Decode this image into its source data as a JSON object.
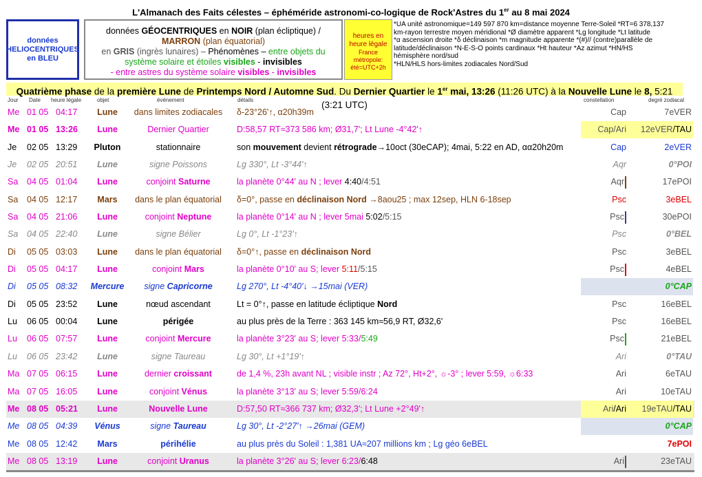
{
  "title": {
    "pre": "L'Almanach des Faits célestes – éphéméride astronomi-co-logique de Rock'Astres du 1",
    "sup": "er",
    "post": " au 8 mai 2024"
  },
  "legend": {
    "helio": [
      "données",
      "HELIOCENTRIQUES",
      "en BLEU"
    ],
    "geo_l1a": "données ",
    "geo_l1b": "GÉOCENTRIQUES",
    "geo_l1c": " en ",
    "geo_l1d": "NOIR",
    "geo_l1e": " (plan écliptique)  /",
    "geo_l2a": "MARRON",
    "geo_l2b": " (plan équatorial)",
    "geo_l3a": "en ",
    "geo_l3b": "GRIS",
    "geo_l3c": " (ingrès lunaires) – ",
    "geo_l3d": "Phénomènes – ",
    "geo_l3e": "entre objets du",
    "geo_l4a": "système solaire et étoiles ",
    "geo_l4b": "visibles",
    "geo_l4c": " - ",
    "geo_l4d": "invisibles",
    "geo_l5a": "- entre astres du système solaire ",
    "geo_l5b": "visibles",
    "geo_l5c": " - ",
    "geo_l5d": "invisibles",
    "hours": [
      "heures en",
      "heure légale",
      "France",
      "métropole:",
      "été=UTC+2h"
    ],
    "abbr": [
      "*UA unité astronomique=149 597 870 km=distance moyenne Terre-Soleil   *RT=6 378,137",
      "km-rayon terrestre moyen méridional   *Ø diamètre apparent  *Lg longitude  *Lt latitude",
      "*α ascension droite  *δ déclinaison  *m magnitude apparente  *(#)// (contre)parallèle de",
      "latitude/déclinaison  *N-E-S-O points cardinaux  *Ht hauteur  *Az azimut   *HN/HS",
      "hémisphère nord/sud",
      "*HLN/HLS hors-limites zodiacales Nord/Sud"
    ]
  },
  "phase": {
    "a": "Quatrième phase",
    "b": " de la ",
    "c": "première Lune",
    "d": " de ",
    "e": "Printemps Nord / Automne Sud",
    "f": ". Du ",
    "g": "Dernier Quartier",
    "h": " le ",
    "i": "1",
    "isup": "er",
    "j": " mai, 13:26",
    "k": " (11:26 UTC) à la ",
    "l": "Nouvelle Lune",
    "m": " le ",
    "n": "8,",
    "o": " 5:21 (3:21 UTC)"
  },
  "headers": {
    "jour": "Jour",
    "date": "Date",
    "heure": "heure légale",
    "objet": "objet",
    "evt": "événement",
    "det": "détails",
    "cst": "constellation",
    "deg": "degré zodiacal"
  },
  "rows": [
    {
      "jour": "Me",
      "date": "01 05",
      "heure": "04:17",
      "obj": "Lune",
      "evt": "dans limites zodiacales",
      "det": "δ-23°26'↑,  α20h39m",
      "cst": "Cap",
      "deg": "7eVER"
    },
    {
      "jour": "Me",
      "date": "01 05",
      "heure": "13:26",
      "obj": "Lune",
      "evt": "Dernier Quartier",
      "det": "D:58,57 RT≈373 586 km; Ø31,7'; Lt Lune -4°42'↑",
      "cst": "Cap/Ari",
      "deg_a": "12eVER",
      "deg_b": "/TAU"
    },
    {
      "jour": "Je",
      "date": "02 05",
      "heure": "13:29",
      "obj": "Pluton",
      "evt": "stationnaire",
      "det_a": "son ",
      "det_b": "mouvement",
      "det_c": " devient ",
      "det_d": "rétrograde",
      "det_e": "→10oct (30eCAP); 4mai, 5:22 en AD, αα20h20m",
      "cst": "Cap",
      "deg": "2eVER"
    },
    {
      "jour": "Je",
      "date": "02 05",
      "heure": "20:51",
      "obj": "Lune",
      "evt": "signe Poissons",
      "det": "Lg 330°, Lt -3°44'↑",
      "cst": "Aqr",
      "deg": "0°POI"
    },
    {
      "jour": "Sa",
      "date": "04 05",
      "heure": "01:04",
      "obj": "Lune",
      "evt_a": "conjoint ",
      "evt_b": "Saturne",
      "det_a": "la planète 0°44' au N ; lever ",
      "det_b": "4:40",
      "det_c": "/4:51",
      "cst": "Aqr",
      "deg": "17ePOI"
    },
    {
      "jour": "Sa",
      "date": "04 05",
      "heure": "12:17",
      "obj": "Mars",
      "evt": "dans le plan équatorial",
      "det_a": "δ=0°, passe en ",
      "det_b": "déclinaison Nord",
      "det_c": " →8aou25 ; max 12sep, HLN 6-18sep",
      "cst": "Psc",
      "deg": "3eBEL"
    },
    {
      "jour": "Sa",
      "date": "04 05",
      "heure": "21:06",
      "obj": "Lune",
      "evt_a": "conjoint ",
      "evt_b": "Neptune",
      "det_a": "la planète 0°14' au N ; lever 5mai ",
      "det_b": "5:02",
      "det_c": "/5:15",
      "cst": "Psc",
      "deg": "30ePOI"
    },
    {
      "jour": "Sa",
      "date": "04 05",
      "heure": "22:40",
      "obj": "Lune",
      "evt": "signe Bélier",
      "det": "Lg 0°, Lt -1°23'↑",
      "cst": "Psc",
      "deg": "0°BEL"
    },
    {
      "jour": "Di",
      "date": "05 05",
      "heure": "03:03",
      "obj": "Lune",
      "evt": "dans le plan équatorial",
      "det_a": "δ=0°↑, passe en ",
      "det_b": "déclinaison Nord",
      "cst": "Psc",
      "deg": "3eBEL"
    },
    {
      "jour": "Di",
      "date": "05 05",
      "heure": "04:17",
      "obj": "Lune",
      "evt_a": "conjoint ",
      "evt_b": "Mars",
      "det_a": "la planète 0°10' au S; lever ",
      "det_b": "5:11",
      "det_c": "/5:15",
      "cst": "Psc",
      "deg": "4eBEL"
    },
    {
      "jour": "Di",
      "date": "05 05",
      "heure": "08:32",
      "obj": "Mercure",
      "evt_a": "signe ",
      "evt_b": "Capricorne",
      "det": "Lg 270°, Lt -4°40'↓ →15mai (VER)",
      "cst": "",
      "deg": "0°CAP"
    },
    {
      "jour": "Di",
      "date": "05 05",
      "heure": "23:52",
      "obj": "Lune",
      "evt": "nœud ascendant",
      "det_a": "Lt = 0°↑, passe en latitude écliptique ",
      "det_b": "Nord",
      "cst": "Psc",
      "deg": "16eBEL"
    },
    {
      "jour": "Lu",
      "date": "06 05",
      "heure": "00:04",
      "obj": "Lune",
      "evt": "périgée",
      "det": "au plus près de la Terre : 363 145 km≈56,9 RT, Ø32,6'",
      "cst": "Psc",
      "deg": "16eBEL"
    },
    {
      "jour": "Lu",
      "date": "06 05",
      "heure": "07:57",
      "obj": "Lune",
      "evt_a": "conjoint ",
      "evt_b": "Mercure",
      "det_a": "la planète 3°23' au S; lever 5:33/",
      "det_b": "5:49",
      "cst": "Psc",
      "deg": "21eBEL"
    },
    {
      "jour": "Lu",
      "date": "06 05",
      "heure": "23:42",
      "obj": "Lune",
      "evt": "signe Taureau",
      "det": "Lg 30°, Lt +1°19'↑",
      "cst": "Ari",
      "deg": "0°TAU"
    },
    {
      "jour": "Ma",
      "date": "07 05",
      "heure": "06:15",
      "obj": "Lune",
      "evt_a": "dernier ",
      "evt_b": "croissant",
      "det": "de 1,4 %, 23h avant NL ; visible instr ; Az 72°, Ht+2°, ☼-3° ; lever 5:59, ☼6:33",
      "cst": "Ari",
      "deg": "6eTAU"
    },
    {
      "jour": "Ma",
      "date": "07 05",
      "heure": "16:05",
      "obj": "Lune",
      "evt_a": "conjoint ",
      "evt_b": "Vénus",
      "det_a": "la planète 3°13' au S; lever 5:59/",
      "det_b": "6:24",
      "cst": "Ari",
      "deg": "10eTAU"
    },
    {
      "jour": "Me",
      "date": "08 05",
      "heure": "05:21",
      "obj": "Lune",
      "evt": "Nouvelle Lune",
      "det": "D:57,50 RT≈366 737 km; Ø32,3'; Lt Lune +2°49'↑",
      "cst_a": "Ari",
      "cst_b": "/Ari",
      "deg_a": "19eTAU",
      "deg_b": "/TAU"
    },
    {
      "jour": "Me",
      "date": "08 05",
      "heure": "04:39",
      "obj": "Vénus",
      "evt_a": "signe ",
      "evt_b": "Taureau",
      "det": "Lg 30°, Lt -2°27'↑ →26mai (GEM)",
      "cst": "",
      "deg": "0°CAP"
    },
    {
      "jour": "Me",
      "date": "08 05",
      "heure": "12:42",
      "obj": "Mars",
      "evt": "périhélie",
      "det": "au plus près du Soleil : 1,381 UA≈207 millions km ; Lg géo 6eBEL",
      "cst": "",
      "deg": "7ePOI"
    },
    {
      "jour": "Me",
      "date": "08 05",
      "heure": "13:19",
      "obj": "Lune",
      "evt_a": "conjoint ",
      "evt_b": "Uranus",
      "det_a": "la planète 3°26' au S; lever 6:23/",
      "det_b": "6:48",
      "cst": "Ari",
      "deg": "23eTAU"
    }
  ],
  "colors": {
    "magenta": "#e000c8",
    "brown": "#7b3f0c",
    "blue": "#1a3ad0",
    "grey": "#888888",
    "green": "#1aa51a",
    "red": "#e00000",
    "yellow": "#ffff99"
  }
}
